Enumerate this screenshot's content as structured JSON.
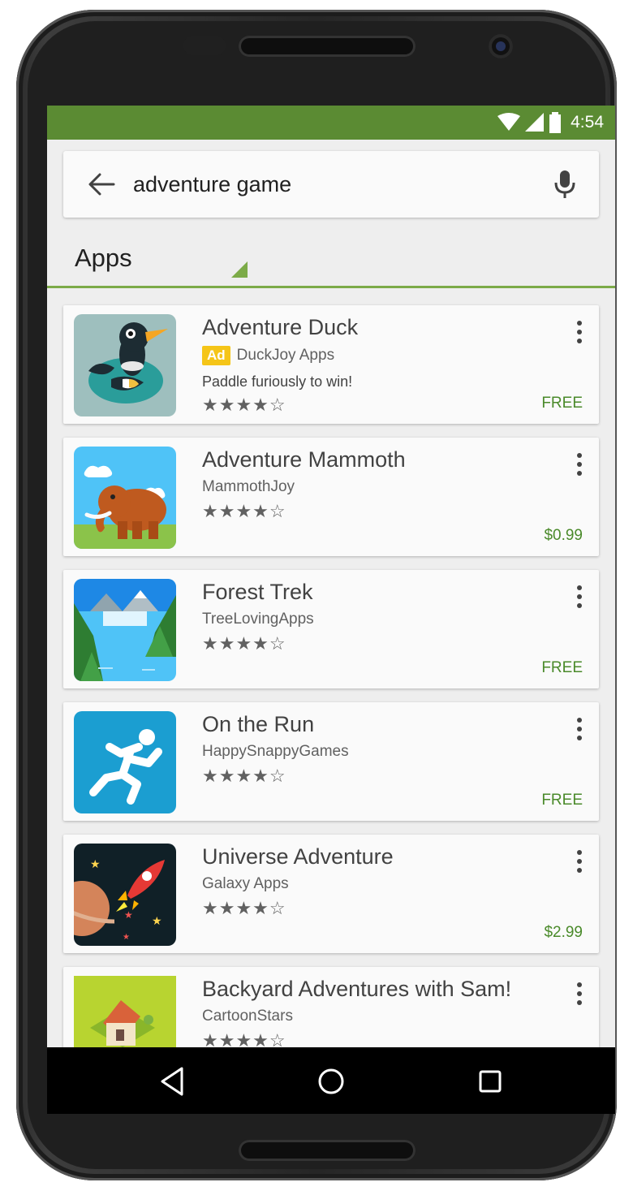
{
  "status_bar": {
    "time": "4:54",
    "color": "#5b8b33"
  },
  "search": {
    "query": "adventure game",
    "placeholder": "adventure game"
  },
  "section": {
    "title": "Apps",
    "accent": "#7cab48"
  },
  "apps": [
    {
      "title": "Adventure Duck",
      "ad_label": "Ad",
      "developer": "DuckJoy Apps",
      "description": "Paddle furiously to win!",
      "stars": "★★★★☆",
      "rating_stars": 4.5,
      "price": "FREE"
    },
    {
      "title": "Adventure Mammoth",
      "developer": "MammothJoy",
      "stars": "★★★★☆",
      "rating_stars": 4.5,
      "price": "$0.99"
    },
    {
      "title": "Forest Trek",
      "developer": "TreeLovingApps",
      "stars": "★★★★☆",
      "rating_stars": 4.5,
      "price": "FREE"
    },
    {
      "title": "On the Run",
      "developer": "HappySnappyGames",
      "stars": "★★★★☆",
      "rating_stars": 4.5,
      "price": "FREE"
    },
    {
      "title": "Universe Adventure",
      "developer": "Galaxy Apps",
      "stars": "★★★★☆",
      "rating_stars": 4.5,
      "price": "$2.99"
    },
    {
      "title": "Backyard Adventures with Sam!",
      "developer": "CartoonStars",
      "stars": "★★★★☆",
      "rating_stars": 4.5,
      "price": ""
    }
  ],
  "icons": {
    "back": "arrow-left-icon",
    "mic": "microphone-icon",
    "more": "more-vert-icon",
    "nav_back": "triangle-back-icon",
    "nav_home": "circle-home-icon",
    "nav_recents": "square-recents-icon"
  }
}
